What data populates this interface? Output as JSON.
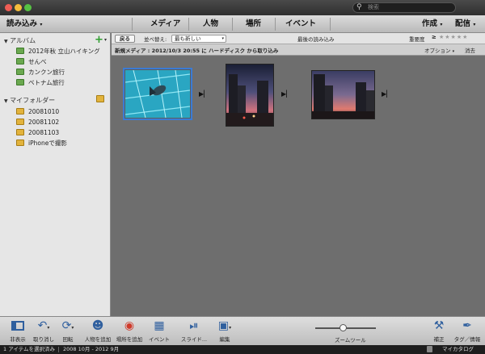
{
  "window": {
    "search_placeholder": "検索"
  },
  "topbar": {
    "import_label": "読み込み",
    "tabs": [
      "メディア",
      "人物",
      "場所",
      "イベント"
    ],
    "create_label": "作成",
    "share_label": "配信"
  },
  "sidebar": {
    "albums_header": "アルバム",
    "albums": [
      "2012年秋 立山ハイキング",
      "せんべ",
      "カンクン旅行",
      "ベトナム旅行"
    ],
    "folders_header": "マイフォルダー",
    "folders": [
      "20081010",
      "20081102",
      "20081103",
      "iPhoneで撮影"
    ]
  },
  "filterbar": {
    "back_label": "戻る",
    "sort_label": "並べ替え:",
    "sort_value": "最も新しい",
    "last_import_label": "最後の読み込み",
    "rating_label": "重要度",
    "rating_op": "≥",
    "rating_stars": "★★★★★",
    "rating_value": 0
  },
  "infobar": {
    "text": "新規メディア : 2012/10/3 20:55 に ハードディスク から取り込み",
    "options_label": "オプション",
    "clear_label": "消去"
  },
  "toolbar": {
    "hide_label": "非表示",
    "undo_label": "取り消し",
    "rotate_label": "回転",
    "add_people_label": "人物を追加",
    "add_place_label": "場所を追加",
    "event_label": "イベント",
    "slideshow_label": "スライド...",
    "edit_label": "編集",
    "zoom_label": "ズームツール",
    "zoom_value": 0.45,
    "fix_label": "補正",
    "tags_label": "タグ／情報"
  },
  "status": {
    "selection": "1 アイテムを選択済み",
    "date_range": "2008 10月 - 2012 9月",
    "catalog_label": "マイカタログ"
  },
  "colors": {
    "accent": "#2f5f9e",
    "album_icon": "#6aa84f",
    "folder_icon": "#e2b33c"
  }
}
